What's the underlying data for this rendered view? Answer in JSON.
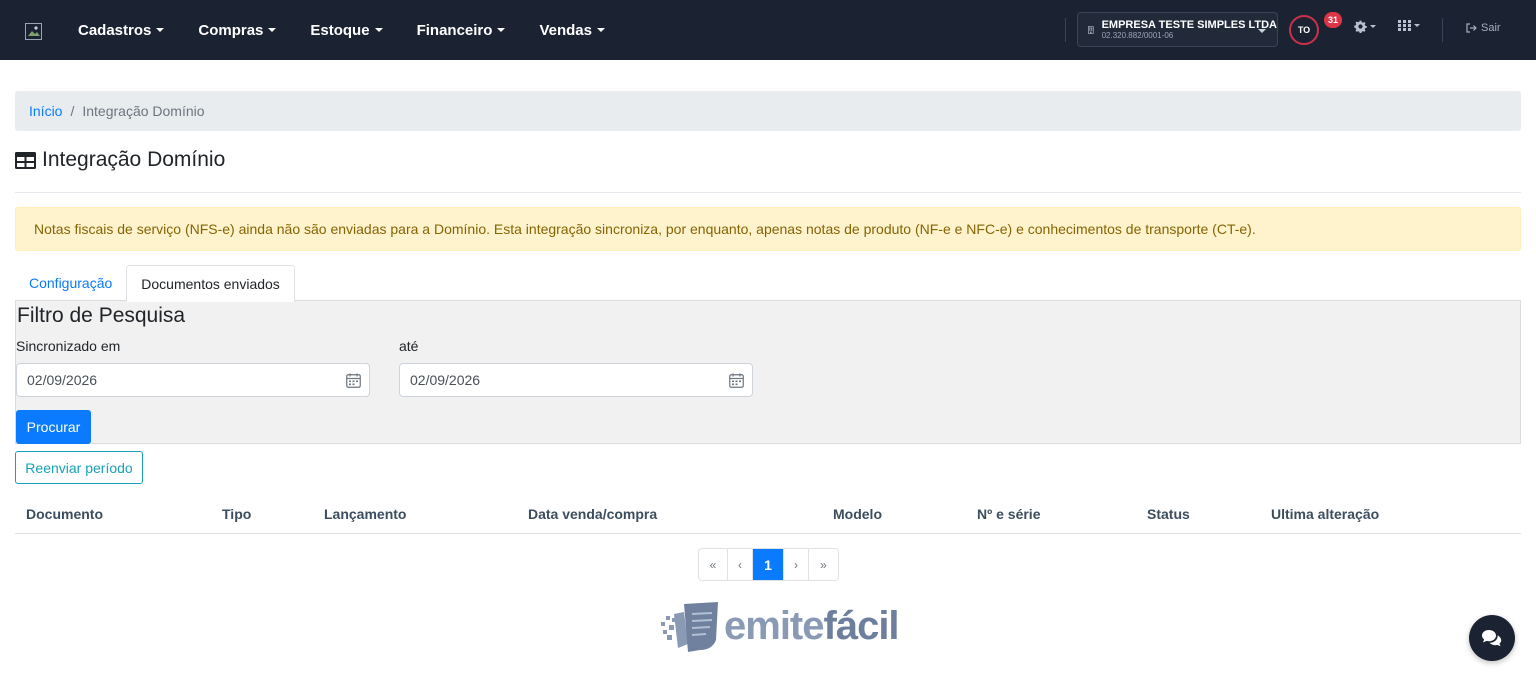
{
  "navbar": {
    "menu": [
      {
        "label": "Cadastros"
      },
      {
        "label": "Compras"
      },
      {
        "label": "Estoque"
      },
      {
        "label": "Financeiro"
      },
      {
        "label": "Vendas"
      }
    ],
    "company": {
      "name": "EMPRESA TESTE SIMPLES LTDA",
      "cnpj": "02.320.882/0001-06"
    },
    "avatar_initials": "TO",
    "notification_count": "31",
    "logout_label": "Sair"
  },
  "breadcrumb": {
    "home": "Início",
    "separator": "/",
    "current": "Integração Domínio"
  },
  "page": {
    "title": "Integração Domínio"
  },
  "alert": {
    "text": "Notas fiscais de serviço (NFS-e) ainda não são enviadas para a Domínio. Esta integração sincroniza, por enquanto, apenas notas de produto (NF-e e NFC-e) e conhecimentos de transporte (CT-e)."
  },
  "tabs": [
    {
      "label": "Configuração",
      "active": false
    },
    {
      "label": "Documentos enviados",
      "active": true
    }
  ],
  "filter": {
    "title": "Filtro de Pesquisa",
    "from_label": "Sincronizado em",
    "from_value": "02/09/2026",
    "to_label": "até",
    "to_value": "02/09/2026",
    "search_label": "Procurar"
  },
  "resend_label": "Reenviar período",
  "table": {
    "columns": [
      "Documento",
      "Tipo",
      "Lançamento",
      "Data venda/compra",
      "Modelo",
      "Nº e série",
      "Status",
      "Ultima alteração"
    ],
    "rows": []
  },
  "pagination": {
    "first": "«",
    "prev": "‹",
    "current": "1",
    "next": "›",
    "last": "»"
  },
  "footer_logo": {
    "part1": "emite",
    "part2": "fácil"
  },
  "colors": {
    "navbar": "#1b2231",
    "primary": "#0a7bff",
    "alert_bg": "#fff3cd",
    "alert_text": "#856404",
    "info": "#17a2b8"
  }
}
